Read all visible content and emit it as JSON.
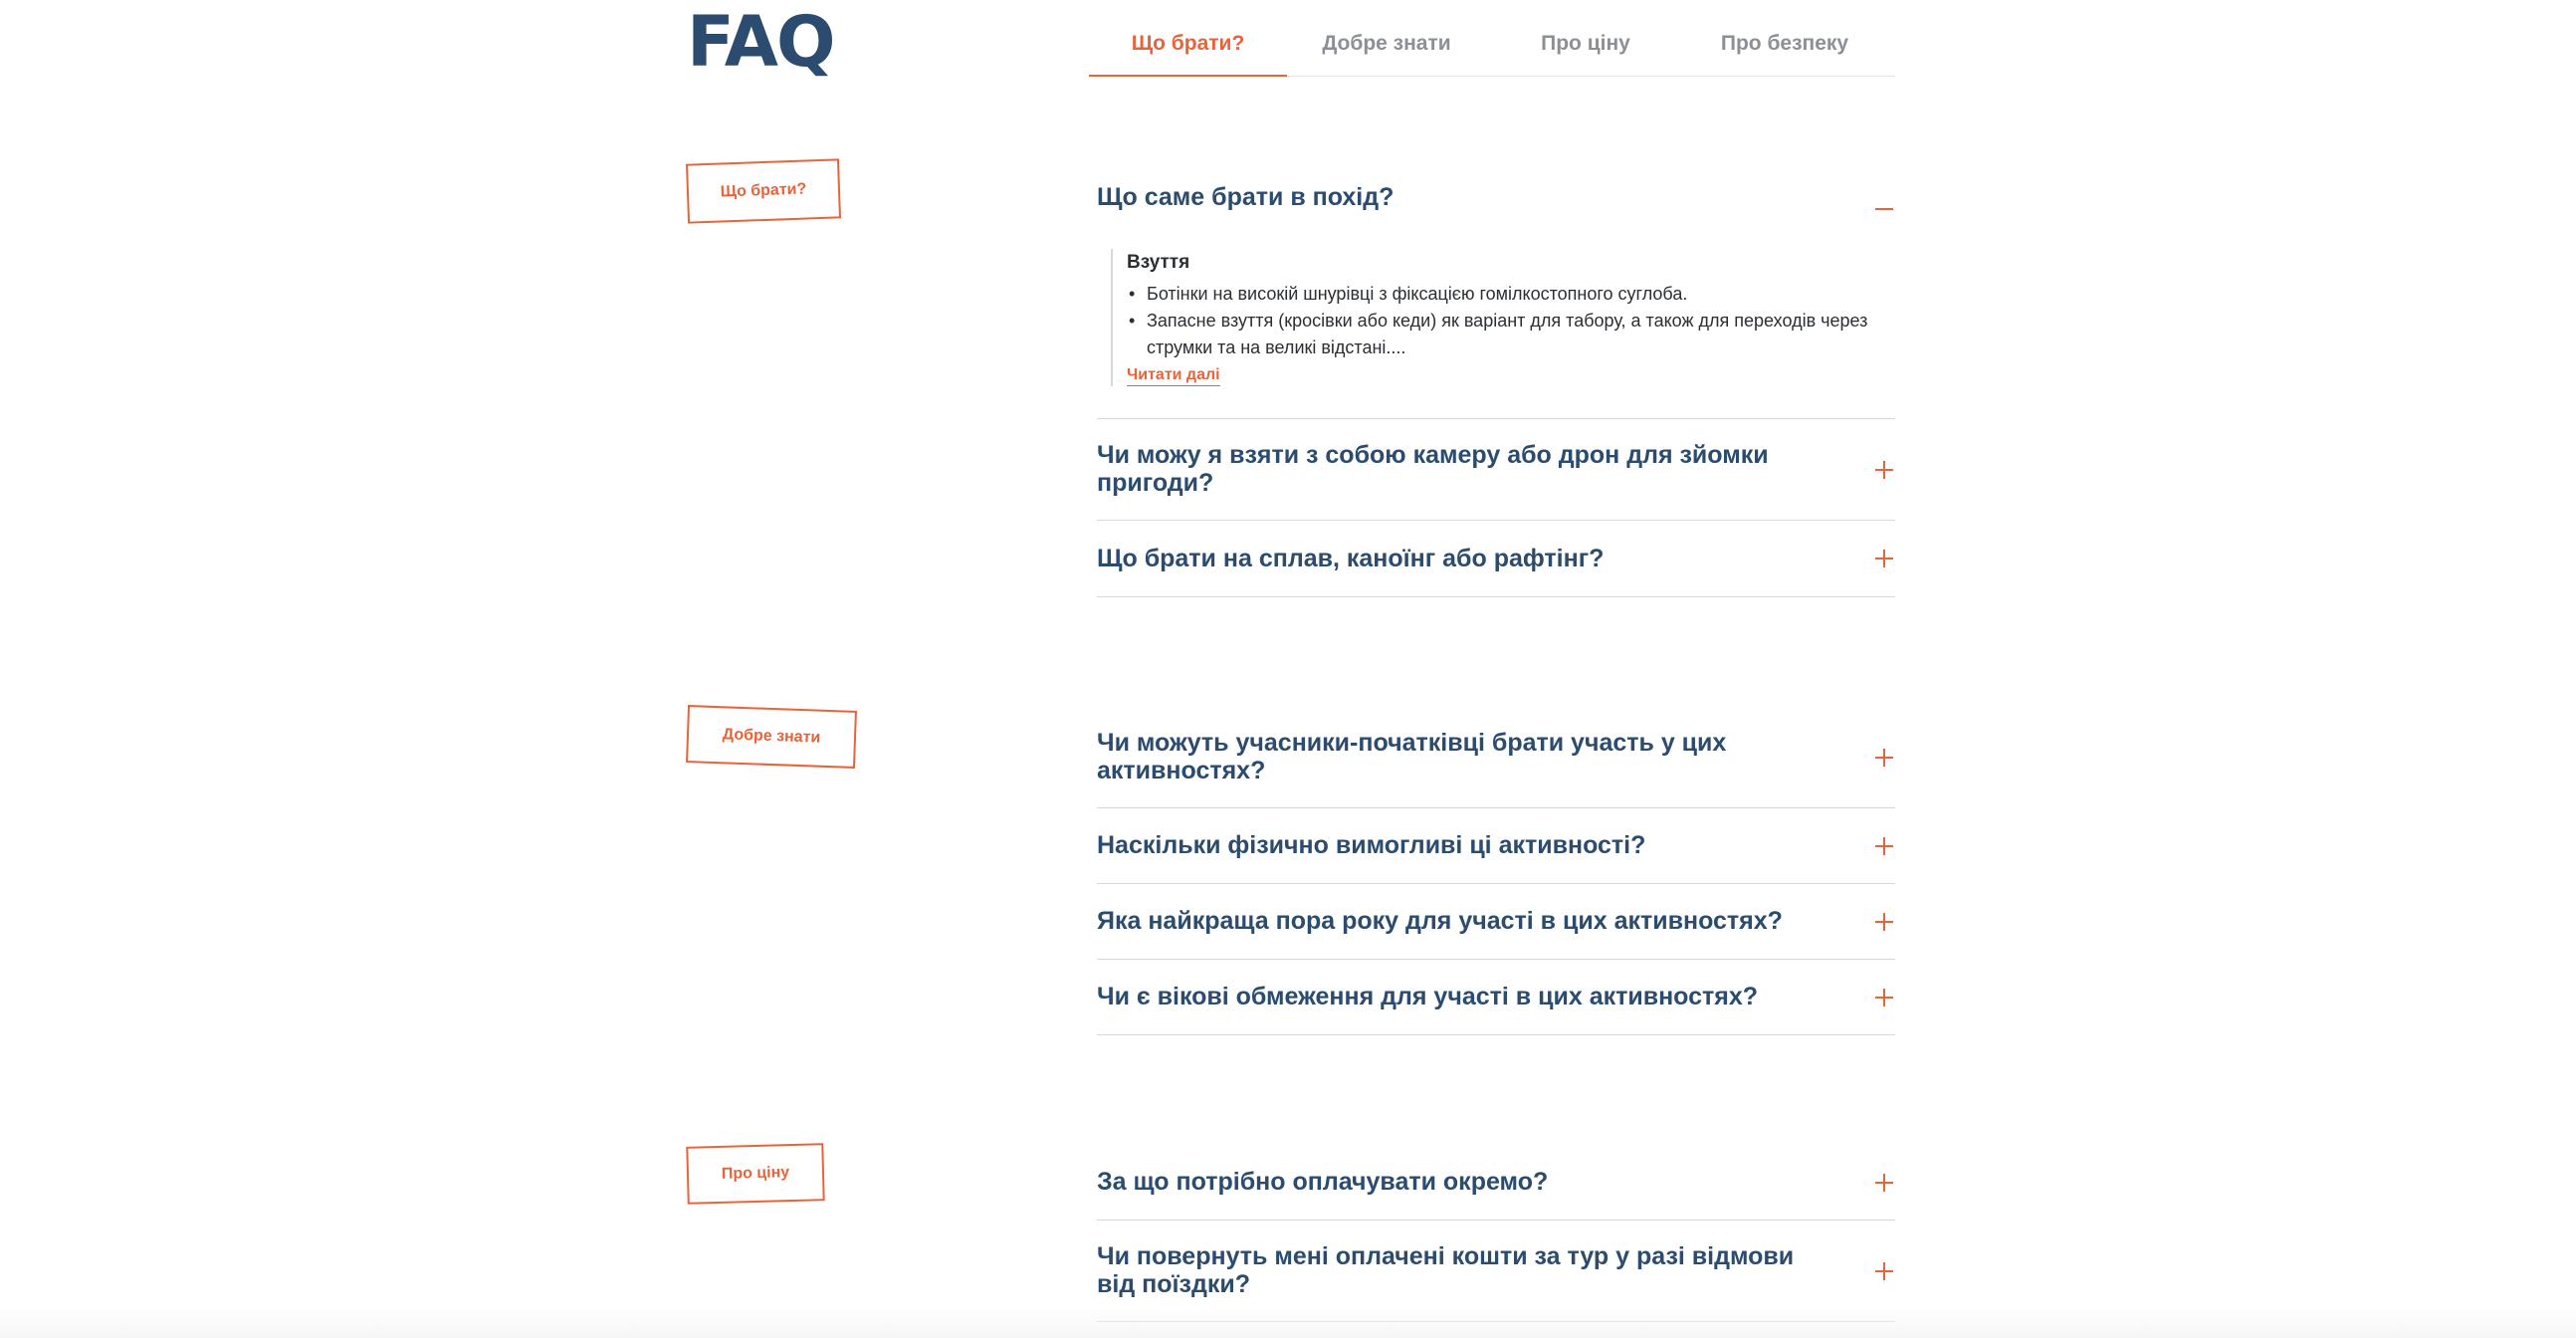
{
  "header": {
    "logo": "FAQ",
    "tabs": [
      {
        "label": "Що брати?",
        "active": true
      },
      {
        "label": "Добре знати",
        "active": false
      },
      {
        "label": "Про ціну",
        "active": false
      },
      {
        "label": "Про безпеку",
        "active": false
      }
    ]
  },
  "sections": [
    {
      "stamp": "Що брати?",
      "questions": [
        {
          "text": "Що саме брати в похід?",
          "expanded": true,
          "answer": {
            "title": "Взуття",
            "items": [
              "Ботінки на високій шнурівці з фіксацією гомілкостопного суглоба.",
              "Запасне взуття (кросівки або кеди) як варіант для табору, а також для переходів через струмки та на великі відстані...."
            ],
            "read_more": "Читати далі"
          }
        },
        {
          "text": "Чи можу я взяти з собою камеру або дрон для зйомки пригоди?",
          "expanded": false
        },
        {
          "text": "Що брати на сплав, каноїнг або рафтінг?",
          "expanded": false
        }
      ]
    },
    {
      "stamp": "Добре знати",
      "questions": [
        {
          "text": "Чи можуть учасники-початківці брати участь у цих активностях?",
          "expanded": false
        },
        {
          "text": "Наскільки фізично вимогливі ці активності?",
          "expanded": false
        },
        {
          "text": "Яка найкраща пора року для участі в цих активностях?",
          "expanded": false
        },
        {
          "text": "Чи є вікові обмеження для участі в цих активностях?",
          "expanded": false
        }
      ]
    },
    {
      "stamp": "Про ціну",
      "questions": [
        {
          "text": "За що потрібно оплачувати окремо?",
          "expanded": false
        },
        {
          "text": "Чи повернуть мені оплачені кошти за тур у разі відмови від поїздки?",
          "expanded": false
        }
      ]
    }
  ],
  "colors": {
    "accent": "#e8633a",
    "heading": "#2b4c6e",
    "divider": "#d4d8dc"
  }
}
